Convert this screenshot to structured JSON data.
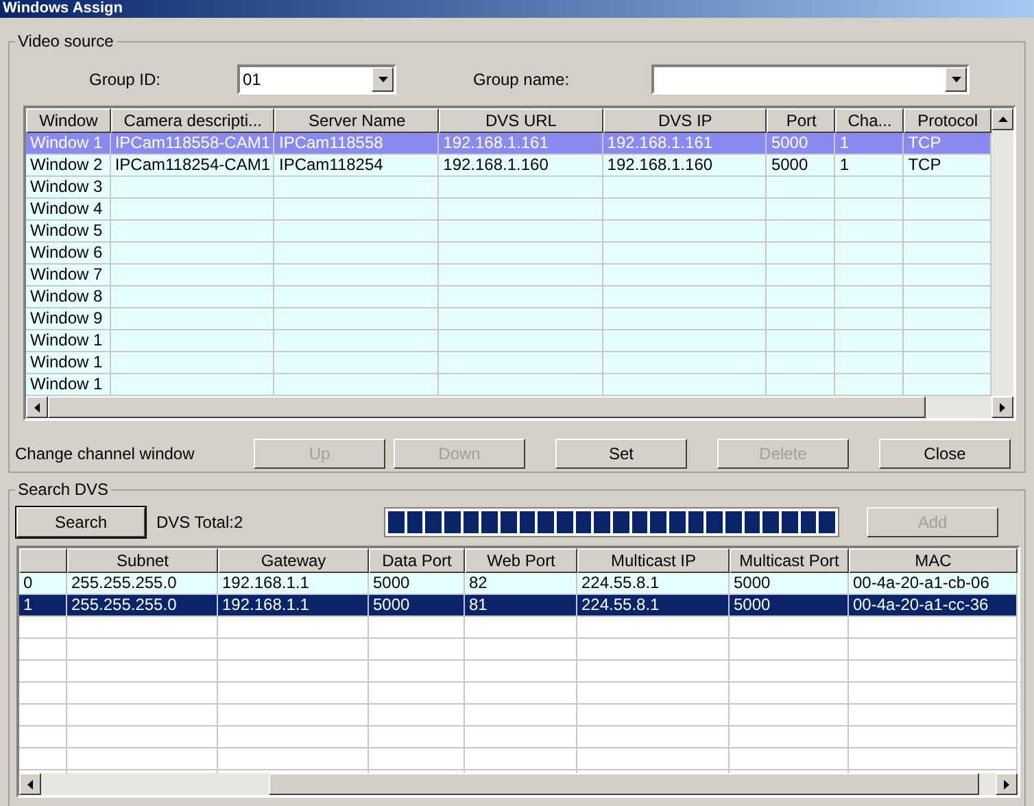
{
  "window": {
    "title": "Windows Assign"
  },
  "video_source": {
    "label": "Video source",
    "group_id": {
      "label": "Group ID:",
      "value": "01"
    },
    "group_name": {
      "label": "Group name:"
    },
    "table": {
      "columns": [
        "Window",
        "Camera descripti...",
        "Server Name",
        "DVS URL",
        "DVS IP",
        "Port",
        "Cha...",
        "Protocol"
      ],
      "rows": [
        {
          "cells": [
            "Window 1",
            "IPCam118558-CAM1",
            "IPCam118558",
            "192.168.1.161",
            "192.168.1.161",
            "5000",
            "1",
            "TCP"
          ],
          "selected": true
        },
        {
          "cells": [
            "Window 2",
            "IPCam118254-CAM1",
            "IPCam118254",
            "192.168.1.160",
            "192.168.1.160",
            "5000",
            "1",
            "TCP"
          ],
          "selected": false
        },
        {
          "cells": [
            "Window 3"
          ],
          "selected": false
        },
        {
          "cells": [
            "Window 4"
          ],
          "selected": false
        },
        {
          "cells": [
            "Window 5"
          ],
          "selected": false
        },
        {
          "cells": [
            "Window 6"
          ],
          "selected": false
        },
        {
          "cells": [
            "Window 7"
          ],
          "selected": false
        },
        {
          "cells": [
            "Window 8"
          ],
          "selected": false
        },
        {
          "cells": [
            "Window 9"
          ],
          "selected": false
        },
        {
          "cells": [
            "Window 1"
          ],
          "selected": false
        },
        {
          "cells": [
            "Window 1"
          ],
          "selected": false
        },
        {
          "cells": [
            "Window 1"
          ],
          "selected": false
        }
      ]
    },
    "change_label": "Change channel window",
    "buttons": [
      {
        "label": "Up",
        "disabled": true
      },
      {
        "label": "Down",
        "disabled": true
      },
      {
        "label": "Set",
        "disabled": false
      },
      {
        "label": "Delete",
        "disabled": true
      },
      {
        "label": "Close",
        "disabled": false
      }
    ]
  },
  "search_dvs": {
    "label": "Search DVS",
    "search_button": "Search",
    "total": "DVS Total:2",
    "progress": {
      "level": 1
    },
    "add_button": {
      "label": "Add",
      "disabled": true
    },
    "table": {
      "columns": [
        "",
        "Subnet",
        "Gateway",
        "Data Port",
        "Web  Port",
        "Multicast IP",
        "Multicast Port",
        "MAC"
      ],
      "rows": [
        {
          "cells": [
            "0",
            "255.255.255.0",
            "192.168.1.1",
            "5000",
            "82",
            "224.55.8.1",
            "5000",
            "00-4a-20-a1-cb-06"
          ],
          "selected": false
        },
        {
          "cells": [
            "1",
            "255.255.255.0",
            "192.168.1.1",
            "5000",
            "81",
            "224.55.8.1",
            "5000",
            "00-4a-20-a1-cc-36"
          ],
          "selected": true
        }
      ]
    }
  }
}
